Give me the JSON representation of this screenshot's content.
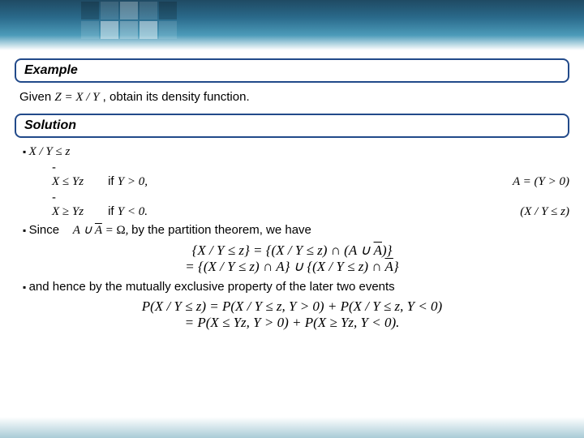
{
  "headers": {
    "example": "Example",
    "solution": "Solution"
  },
  "given": {
    "prefix": "Given ",
    "expr": "Z = X / Y",
    "suffix": ", obtain its density function."
  },
  "bullet1": {
    "event": "X / Y ≤ z",
    "case1": {
      "cond": "X ≤ Yz",
      "if": " if ",
      "when": "Y > 0,",
      "set": "A = (Y > 0)"
    },
    "case2": {
      "cond": "X ≥ Yz",
      "if": " if ",
      "when": "Y < 0.",
      "set": "(X / Y ≤ z)"
    }
  },
  "bullet2": {
    "since": "Since",
    "rel": "A ∪ A̅ = Ω,",
    "tail": " by the partition theorem, we have"
  },
  "partition": {
    "line1": "{X / Y ≤ z} = {(X / Y ≤ z) ∩ (A ∪ A̅)}",
    "line2": "= {(X / Y ≤ z) ∩ A} ∪ {(X / Y ≤ z) ∩ A̅}"
  },
  "bullet3": "and hence by the mutually exclusive property of the later two events",
  "prob": {
    "line1": "P(X / Y ≤ z) = P(X / Y ≤ z, Y > 0) + P(X / Y ≤ z, Y < 0)",
    "line2": "= P(X ≤ Yz, Y > 0) + P(X ≥ Yz, Y < 0)."
  }
}
